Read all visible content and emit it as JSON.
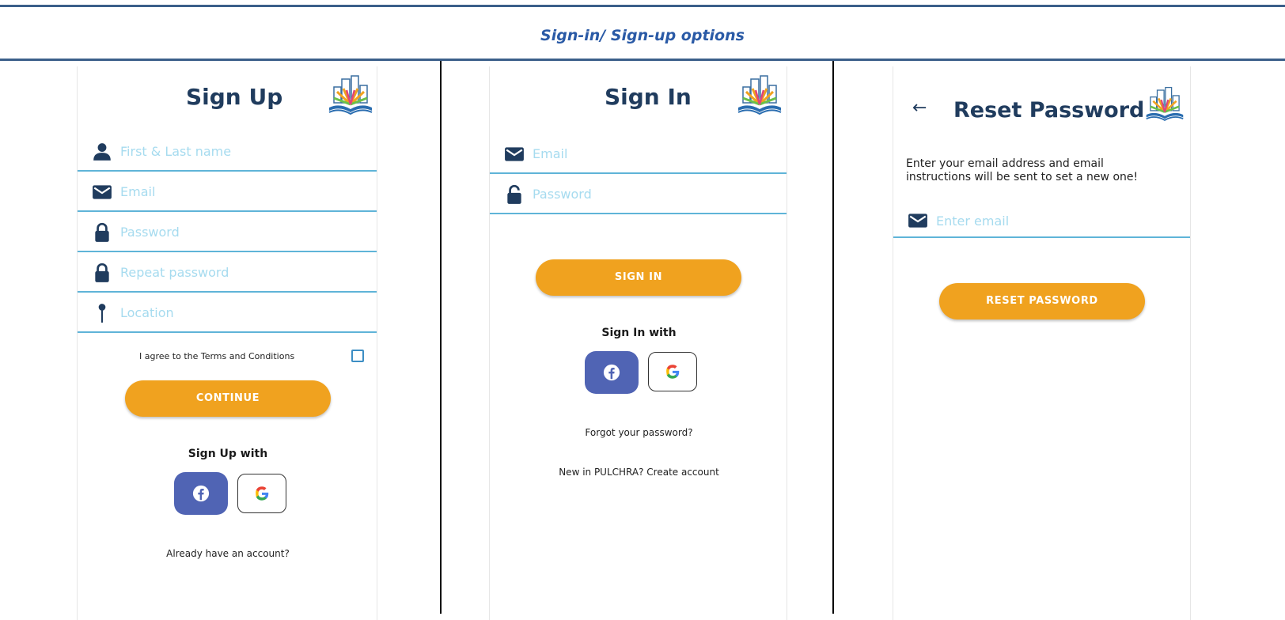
{
  "caption": "Sign-in/ Sign-up options",
  "signup": {
    "title": "Sign Up",
    "fields": [
      {
        "icon": "person-icon",
        "placeholder": "First & Last name"
      },
      {
        "icon": "envelope-icon",
        "placeholder": "Email"
      },
      {
        "icon": "lock-icon",
        "placeholder": "Password"
      },
      {
        "icon": "lock-icon",
        "placeholder": "Repeat password"
      },
      {
        "icon": "location-pin-icon",
        "placeholder": "Location"
      }
    ],
    "terms_label": "I agree to the Terms and Conditions",
    "continue_label": "CONTINUE",
    "with_label": "Sign Up with",
    "already_label": "Already have an account?"
  },
  "signin": {
    "title": "Sign In",
    "fields": [
      {
        "icon": "envelope-icon",
        "placeholder": "Email"
      },
      {
        "icon": "unlock-icon",
        "placeholder": "Password"
      }
    ],
    "signin_label": "SIGN IN",
    "with_label": "Sign In with",
    "forgot_label": "Forgot your password?",
    "new_label": "New in PULCHRA? Create account"
  },
  "reset": {
    "back_arrow": "←",
    "title": "Reset Password",
    "description_line1": "Enter your email address and email",
    "description_line2": "instructions will be sent to set a new one!",
    "email_placeholder": "Enter email",
    "reset_label": "RESET PASSWORD"
  },
  "colors": {
    "accent": "#f0a21f",
    "title": "#203c5e",
    "facebook": "#5064b4",
    "field_underline": "#5fb4d8",
    "placeholder": "#a6dbef",
    "rule": "#3b5f8a"
  }
}
